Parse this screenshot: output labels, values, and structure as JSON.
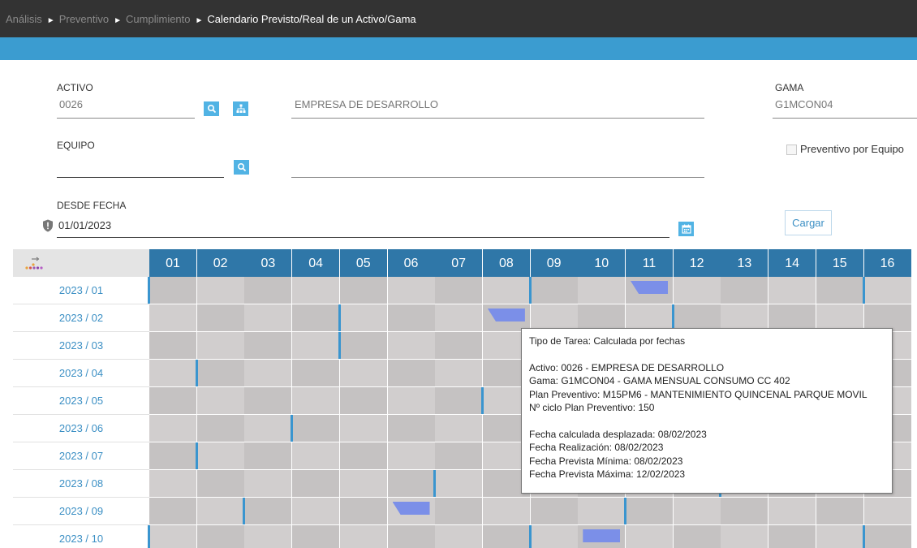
{
  "breadcrumb": {
    "items": [
      "Análisis",
      "Preventivo",
      "Cumplimiento"
    ],
    "current": "Calendario Previsto/Real de un Activo/Gama"
  },
  "form": {
    "activo_label": "ACTIVO",
    "activo_value": "0026",
    "activo_desc": "EMPRESA DE DESARROLLO",
    "gama_label": "GAMA",
    "gama_value": "G1MCON04",
    "equipo_label": "EQUIPO",
    "equipo_value": "",
    "equipo_desc": "",
    "preventivo_equipo_label": "Preventivo por Equipo",
    "preventivo_equipo_checked": false,
    "desde_fecha_label": "DESDE FECHA",
    "desde_fecha_value": "01/01/2023",
    "cargar_label": "Cargar"
  },
  "icons": {
    "search": "search-icon",
    "hierarchy": "hierarchy-icon",
    "calendar": "calendar-icon",
    "shield": "shield-info-icon",
    "corner": "dots-arrow-icon"
  },
  "colors": {
    "topbar": "#333333",
    "accent_bar": "#3b9cd0",
    "header_cell": "#2f77a8",
    "icon_button": "#51b3e4",
    "marker": "#3a95cf",
    "task_flag": "#7b8fe8",
    "cell_dark": "#c5c2c2",
    "cell_light": "#d1cece"
  },
  "calendar": {
    "days": [
      "01",
      "02",
      "03",
      "04",
      "05",
      "06",
      "07",
      "08",
      "09",
      "10",
      "11",
      "12",
      "13",
      "14",
      "15",
      "16"
    ],
    "months": [
      "2023 / 01",
      "2023 / 02",
      "2023 / 03",
      "2023 / 04",
      "2023 / 05",
      "2023 / 06",
      "2023 / 07",
      "2023 / 08",
      "2023 / 09",
      "2023 / 10"
    ],
    "markers": [
      [
        1,
        1
      ],
      [
        1,
        9
      ],
      [
        1,
        16
      ],
      [
        2,
        5
      ],
      [
        2,
        12
      ],
      [
        3,
        5
      ],
      [
        4,
        2
      ],
      [
        4,
        16
      ],
      [
        5,
        8
      ],
      [
        6,
        4
      ],
      [
        7,
        2
      ],
      [
        7,
        16
      ],
      [
        8,
        7
      ],
      [
        8,
        13
      ],
      [
        9,
        3
      ],
      [
        9,
        11
      ],
      [
        10,
        1
      ],
      [
        10,
        9
      ],
      [
        10,
        16
      ]
    ],
    "task_flags": [
      {
        "month": 1,
        "day": 11,
        "style": "tl"
      },
      {
        "month": 2,
        "day": 8,
        "style": "tl"
      },
      {
        "month": 9,
        "day": 6,
        "style": "tl"
      },
      {
        "month": 10,
        "day": 10,
        "style": "br"
      }
    ]
  },
  "tooltip": {
    "tipo": "Tipo de Tarea: Calculada por fechas",
    "activo": "Activo: 0026 - EMPRESA DE DESARROLLO",
    "gama": "Gama: G1MCON04 - GAMA MENSUAL CONSUMO CC 402",
    "plan": "Plan Preventivo: M15PM6 - MANTENIMIENTO QUINCENAL PARQUE MOVIL",
    "ciclo": "Nº ciclo Plan Preventivo: 150",
    "fecha_desplazada": "Fecha calculada desplazada: 08/02/2023",
    "fecha_realizacion": "Fecha Realización: 08/02/2023",
    "fecha_min": "Fecha Prevista Mínima: 08/02/2023",
    "fecha_max": "Fecha Prevista Máxima: 12/02/2023"
  }
}
